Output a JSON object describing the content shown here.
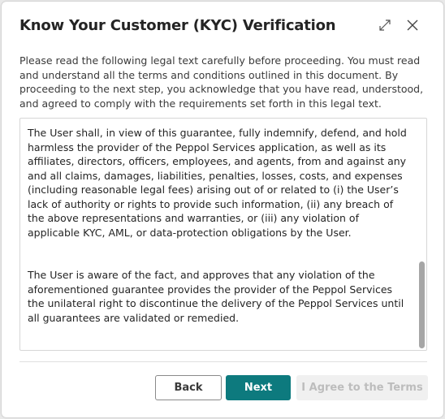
{
  "dialog": {
    "title": "Know Your Customer (KYC) Verification",
    "expand_icon": "expand-icon",
    "close_icon": "close-icon"
  },
  "intro": "Please read the following legal text carefully before proceeding. You must read and understand all the terms and conditions outlined in this document. By proceeding to the next step, you acknowledge that you have read, understood, and agreed to comply with the requirements set forth in this legal text.",
  "legal": {
    "paragraphs": [
      "The User shall, in view of this guarantee, fully indemnify, defend, and hold harmless the provider of the Peppol Services application, as well as its affiliates, directors, officers, employees, and agents, from and against any and all claims, damages, liabilities, penalties, losses, costs, and expenses (including reasonable legal fees) arising out of or related to (i) the User’s lack of authority or rights to provide such information, (ii) any breach of the above representations and warranties, or (iii) any violation of applicable KYC, AML, or data-protection obligations by the User.",
      "The User is aware of the fact, and approves that any violation of the aforementioned guarantee provides the provider of the Peppol Services the unilateral right to discontinue the delivery of the Peppol Services until all guarantees are validated or remedied."
    ]
  },
  "buttons": {
    "back": "Back",
    "next": "Next",
    "agree": "I Agree to the Terms"
  },
  "colors": {
    "primary": "#0d7a7e",
    "disabled_bg": "#f0f0f0",
    "disabled_text": "#bdbdbd"
  }
}
